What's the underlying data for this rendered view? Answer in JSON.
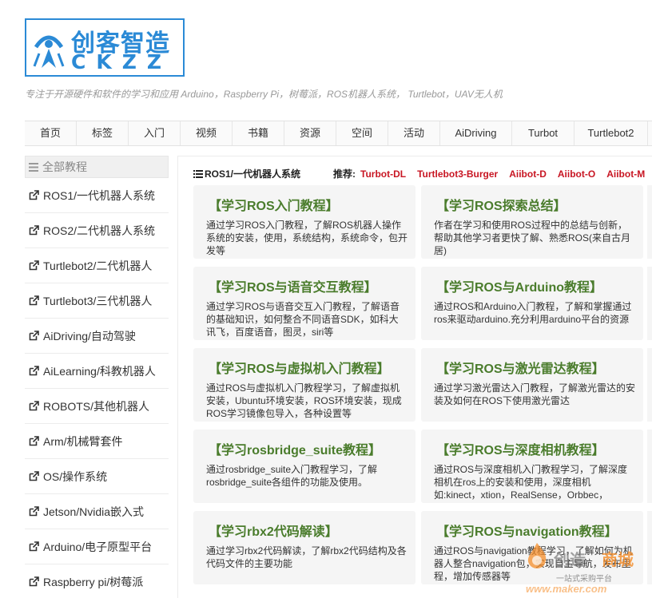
{
  "logo": {
    "text_cn": "创客智造",
    "text_en": "CKZZ"
  },
  "tagline": "专注于开源硬件和软件的学习和应用 Arduino，Raspberry Pi，树莓派，ROS机器人系统， Turtlebot，UAV无人机",
  "nav": {
    "items": [
      "首页",
      "标签",
      "入门",
      "视频",
      "书籍",
      "资源",
      "空间",
      "活动",
      "AiDriving",
      "Turbot",
      "Turtlebot2"
    ]
  },
  "sidebar": {
    "header": "全部教程",
    "items": [
      "ROS1/一代机器人系统",
      "ROS2/二代机器人系统",
      "Turtlebot2/二代机器人",
      "Turtlebot3/三代机器人",
      "AiDriving/自动驾驶",
      "AiLearning/科教机器人",
      "ROBOTS/其他机器人",
      "Arm/机械臂套件",
      "OS/操作系统",
      "Jetson/Nvidia嵌入式",
      "Arduino/电子原型平台",
      "Raspberry pi/树莓派"
    ]
  },
  "main": {
    "section_title": "ROS1/一代机器人系统",
    "recommend_label": "推荐:",
    "recommend_links": [
      "Turbot-DL",
      "Turtlebot3-Burger",
      "Aiibot-D",
      "Aiibot-O",
      "Aiibot-M"
    ],
    "cards": [
      {
        "title": "【学习ROS入门教程】",
        "desc": "通过学习ROS入门教程，了解ROS机器人操作系统的安装，使用，系统结构，系统命令，包开发等"
      },
      {
        "title": "【学习ROS探索总结】",
        "desc": "作者在学习和使用ROS过程中的总结与创新，帮助其他学习者更快了解、熟悉ROS(来自古月居)"
      },
      {
        "title": "【学习ROS与语音交互教程】",
        "desc": "通过学习ROS与语音交互入门教程，了解语音的基础知识，如何整合不同语音SDK，如科大讯飞，百度语音，图灵，siri等"
      },
      {
        "title": "【学习ROS与Arduino教程】",
        "desc": "通过ROS和Arduino入门教程，了解和掌握通过ros来驱动arduino.充分利用arduino平台的资源"
      },
      {
        "title": "【学习ROS与虚拟机入门教程】",
        "desc": "通过ROS与虚拟机入门教程学习，了解虚拟机安装，Ubuntu环境安装，ROS环境安装，现成ROS学习镜像包导入，各种设置等"
      },
      {
        "title": "【学习ROS与激光雷达教程】",
        "desc": "通过学习激光雷达入门教程，了解激光雷达的安装及如何在ROS下使用激光雷达"
      },
      {
        "title": "【学习rosbridge_suite教程】",
        "desc": "通过rosbridge_suite入门教程学习，了解rosbridge_suite各组件的功能及使用。"
      },
      {
        "title": "【学习ROS与深度相机教程】",
        "desc": "通过ROS与深度相机入门教程学习，了解深度相机在ros上的安装和使用，深度相机如:kinect，xtion，RealSense，Orbbec，"
      },
      {
        "title": "【学习rbx2代码解读】",
        "desc": "通过学习rbx2代码解读，了解rbx2代码结构及各代码文件的主要功能"
      },
      {
        "title": "【学习ROS与navigation教程】",
        "desc": "通过ROS与navigation教程学习，了解如何为机器人整合navigation包，实现自主导航，发布里程，增加传感器等"
      }
    ]
  },
  "watermark": {
    "brand": "创造",
    "brand_accent": "商城",
    "sub": "一站式采购平台",
    "url": "www.maker.com"
  },
  "colors": {
    "brand_blue": "#2b8ad6",
    "card_title_green": "#4a7c2c",
    "link_red": "#c81623",
    "card_bg": "#f5f5f5"
  }
}
